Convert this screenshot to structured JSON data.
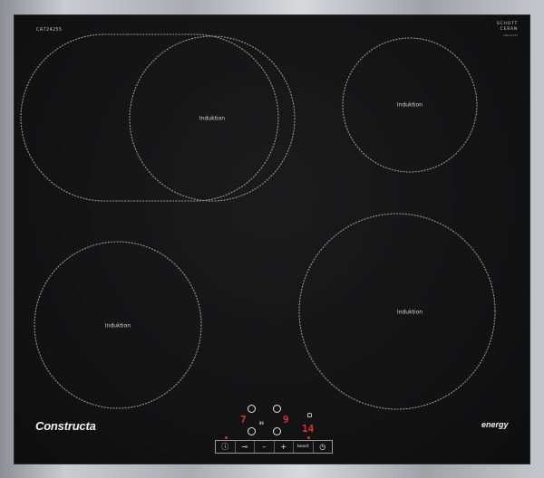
{
  "hob": {
    "model_code": "CA724255",
    "certification": {
      "line1": "SCHOTT",
      "line2": "CERAN",
      "sub": "ABC12345"
    },
    "zones": [
      {
        "id": "front-left-large",
        "label": "Induktion"
      },
      {
        "id": "back-right-small",
        "label": "Induktion"
      },
      {
        "id": "bottom-left",
        "label": "Induktion"
      },
      {
        "id": "bottom-right-large",
        "label": "Induktion"
      }
    ],
    "brand": "Constructa",
    "energy_label": "energy",
    "display": {
      "left_digit": "7",
      "left_digit2": "9",
      "right_digit": "14",
      "mid_small": "88"
    },
    "controls": {
      "info": "ⓘ",
      "key": "⊸",
      "minus": "–",
      "plus": "+",
      "boost": "boost",
      "timer": "◷"
    }
  }
}
